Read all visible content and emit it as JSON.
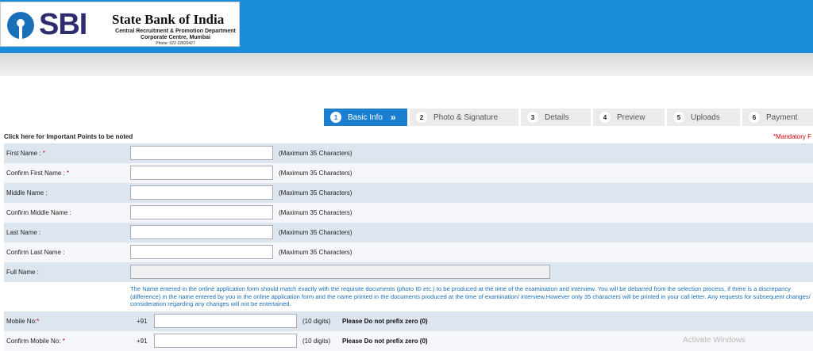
{
  "header": {
    "logo_text": "SBI",
    "bank_name": "State Bank of India",
    "dept": "Central Recruitment & Promotion Department",
    "centre": "Corporate Centre, Mumbai",
    "phone": "Phone: 022-22820427"
  },
  "steps": [
    {
      "num": "1",
      "label": "Basic Info"
    },
    {
      "num": "2",
      "label": "Photo & Signature"
    },
    {
      "num": "3",
      "label": "Details"
    },
    {
      "num": "4",
      "label": "Preview"
    },
    {
      "num": "5",
      "label": "Uploads"
    },
    {
      "num": "6",
      "label": "Payment"
    }
  ],
  "links": {
    "important": "Click here for Important Points to be noted",
    "mandatory": "*Mandatory F"
  },
  "form": {
    "first_name": {
      "label": "First Name : ",
      "hint": "(Maximum 35 Characters)"
    },
    "confirm_first_name": {
      "label": "Confirm First Name : ",
      "hint": "(Maximum 35 Characters)"
    },
    "middle_name": {
      "label": "Middle Name :",
      "hint": "(Maximum 35 Characters)"
    },
    "confirm_middle_name": {
      "label": "Confirm Middle Name :",
      "hint": "(Maximum 35 Characters)"
    },
    "last_name": {
      "label": "Last Name :",
      "hint": "(Maximum 35 Characters)"
    },
    "confirm_last_name": {
      "label": "Confirm Last Name :",
      "hint": "(Maximum 35 Characters)"
    },
    "full_name": {
      "label": "Full Name :"
    },
    "note": "The Name entered in the online application form should match exactly with the requisite documents (photo ID etc.) to be produced at the time of the examination and interview. You will be debarred from the selection process, if there is a discrepancy (difference) in the name entered by you in the online application form and the name printed in the documents produced at the time of examination/ interview.However only 35 characters will be printed in your call letter. Any requests for subsequent changes/ consideration regarding any changes will not be entertained.",
    "mobile": {
      "label": "Mobile No:",
      "prefix": "+91",
      "digits": "(10 digits)",
      "warn": "Please Do not prefix zero (0)"
    },
    "confirm_mobile": {
      "label": "Confirm Mobile No:",
      "prefix": "+91",
      "digits": "(10 digits)",
      "warn": "Please Do not prefix zero (0)"
    }
  },
  "watermark": "Activate Windows",
  "colors": {
    "topbar": "#1a8cd8",
    "active_step": "#1a7fd1",
    "required": "#cc0000",
    "note_text": "#1a6fb8"
  }
}
